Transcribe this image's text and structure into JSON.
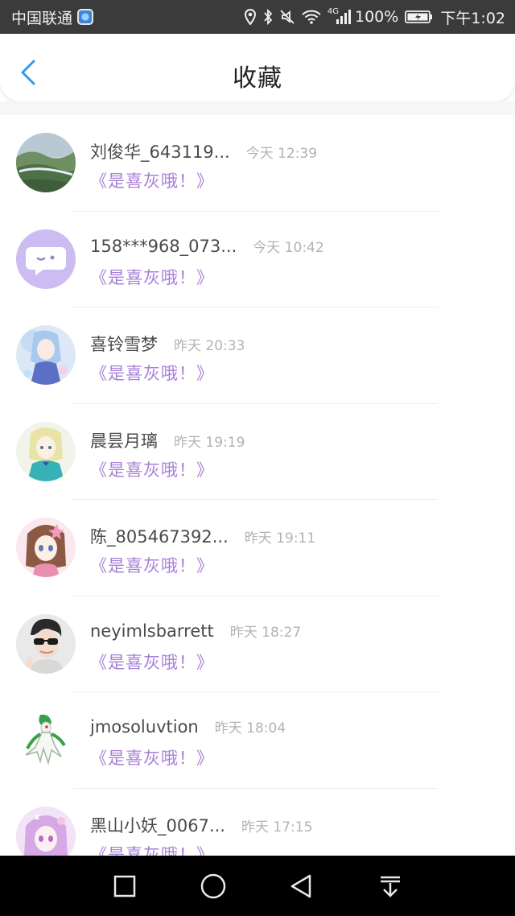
{
  "status_bar": {
    "carrier": "中国联通",
    "network": "4G",
    "battery": "100%",
    "time": "下午1:02"
  },
  "header": {
    "title": "收藏",
    "back_icon": "chevron-left-icon",
    "accent_color": "#2f9bf0"
  },
  "items": [
    {
      "name": "刘俊华_643119...",
      "time": "今天 12:39",
      "snippet": "《是喜灰哦！》"
    },
    {
      "name": "158***968_073...",
      "time": "今天 10:42",
      "snippet": "《是喜灰哦！》"
    },
    {
      "name": "喜铃雪梦",
      "time": "昨天 20:33",
      "snippet": "《是喜灰哦！》"
    },
    {
      "name": "晨昙月璃",
      "time": "昨天 19:19",
      "snippet": "《是喜灰哦！》"
    },
    {
      "name": "陈_805467392...",
      "time": "昨天 19:11",
      "snippet": "《是喜灰哦！》"
    },
    {
      "name": "neyimlsbarrett",
      "time": "昨天 18:27",
      "snippet": "《是喜灰哦！》"
    },
    {
      "name": "jmosoluvtion",
      "time": "昨天 18:04",
      "snippet": "《是喜灰哦！》"
    },
    {
      "name": "黑山小妖_0067...",
      "time": "昨天 17:15",
      "snippet": "《是喜灰哦！》"
    }
  ],
  "snippet_color": "#a77fd8",
  "nav_bar": [
    "recent-apps-icon",
    "home-icon",
    "back-triangle-icon",
    "notification-pull-icon"
  ]
}
